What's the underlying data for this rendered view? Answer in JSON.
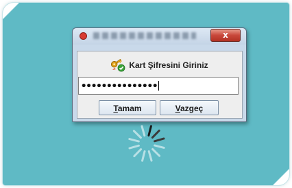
{
  "dialog": {
    "title_label_blurred": true,
    "close_label": "x",
    "heading": "Kart Şifresini Giriniz",
    "password_value": "•••••••••••••••",
    "ok_button": {
      "mnemonic": "T",
      "rest": "amam"
    },
    "cancel_button": {
      "mnemonic": "V",
      "rest": "azgeç"
    }
  },
  "icons": {
    "app": "app-icon",
    "heading": "key-check-icon",
    "loading": "loading-spinner-icon"
  },
  "colors": {
    "background_panel": "#5fbac5",
    "dialog_frame": "#c9d9ea",
    "close_button": "#c8473a",
    "check_badge": "#3aa43a",
    "key_gold": "#e0a21c"
  }
}
